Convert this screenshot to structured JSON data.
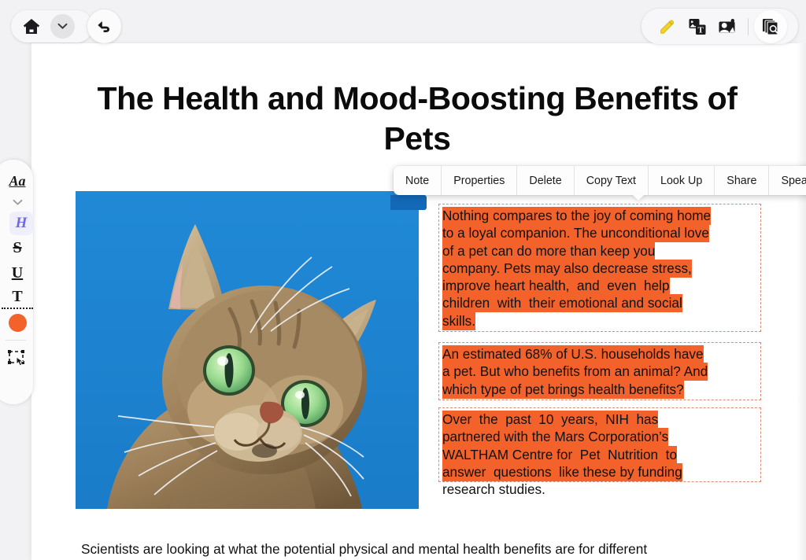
{
  "window": {
    "background_color": "#f2f2f4",
    "page_background": "#ffffff"
  },
  "top_left_controls": {
    "home_button": {
      "icon": "home-icon",
      "label": "Home"
    },
    "dropdown_button": {
      "icon": "chevron-down-icon",
      "label": "Open navigation"
    },
    "undo_button": {
      "icon": "undo-arrow-icon",
      "label": "Undo"
    }
  },
  "top_right_toolbar": {
    "items": [
      {
        "icon": "highlighter-pen-icon",
        "label": "Highlight",
        "color": "#f2d22e",
        "active": true
      },
      {
        "icon": "image-to-text-icon",
        "label": "Image to Text"
      },
      {
        "icon": "person-photo-icon",
        "label": "Describe Image"
      },
      {
        "icon": "page-stack-search-icon",
        "label": "Search Pages"
      }
    ]
  },
  "sidebar": {
    "items": [
      {
        "id": "text-style",
        "icon": "aa-text-style-icon",
        "label": "Aa"
      },
      {
        "id": "expand",
        "icon": "chevron-down-icon",
        "label": "⌄"
      },
      {
        "id": "highlight",
        "icon": "h-highlight-icon",
        "label": "H",
        "color": "#6f6bdd",
        "active": true
      },
      {
        "id": "strikethrough",
        "icon": "s-strikethrough-icon",
        "label": "S"
      },
      {
        "id": "underline",
        "icon": "u-underline-icon",
        "label": "U"
      },
      {
        "id": "text",
        "icon": "t-text-icon",
        "label": "T"
      },
      {
        "id": "color",
        "icon": "color-swatch-icon",
        "label": "Color",
        "color": "#f4622c"
      },
      {
        "id": "select",
        "icon": "select-area-hand-icon",
        "label": "Select"
      }
    ]
  },
  "context_menu": {
    "items": [
      {
        "label": "Note"
      },
      {
        "label": "Properties"
      },
      {
        "label": "Delete"
      },
      {
        "label": "Copy Text"
      },
      {
        "label": "Look Up"
      },
      {
        "label": "Share"
      },
      {
        "label": "Speak"
      }
    ]
  },
  "document": {
    "title": "The Health and Mood-Boosting Benefits of Pets",
    "image": {
      "alt": "Tabby cat looking up against a blue sky background",
      "background_color": "#1b81d0"
    },
    "highlight_color": "#f4622c",
    "paragraphs": [
      {
        "id": "p1",
        "lines": [
          {
            "text": "Nothing compares to the joy of coming home",
            "highlighted": true
          },
          {
            "text": "to a loyal companion. The unconditional love",
            "highlighted": true
          },
          {
            "text": "of a pet can do more than keep you",
            "highlighted": true
          },
          {
            "text": "company. Pets may also decrease stress,",
            "highlighted": true
          },
          {
            "text": "improve heart health,  and  even  help",
            "highlighted": true
          },
          {
            "text": "children  with  their emotional and social",
            "highlighted": true
          },
          {
            "text": "skills.",
            "highlighted": true
          }
        ]
      },
      {
        "id": "p2",
        "lines": [
          {
            "text": "An estimated 68% of U.S. households have",
            "highlighted": true
          },
          {
            "text": "a pet. But who benefits from an animal? And",
            "highlighted": true
          },
          {
            "text": "which type of pet brings health benefits?",
            "highlighted": true
          }
        ]
      },
      {
        "id": "p3",
        "lines": [
          {
            "text": "Over  the  past  10  years,  NIH  has",
            "highlighted": true
          },
          {
            "text": "partnered with the Mars Corporation’s",
            "highlighted": true
          },
          {
            "text": "WALTHAM Centre for  Pet  Nutrition  to",
            "highlighted": true
          },
          {
            "text": "answer  questions  like these by funding",
            "highlighted": true
          },
          {
            "text": "research studies.",
            "highlighted": false
          }
        ]
      }
    ],
    "bottom_text": "Scientists are looking at what the potential physical and mental health benefits are for different"
  }
}
